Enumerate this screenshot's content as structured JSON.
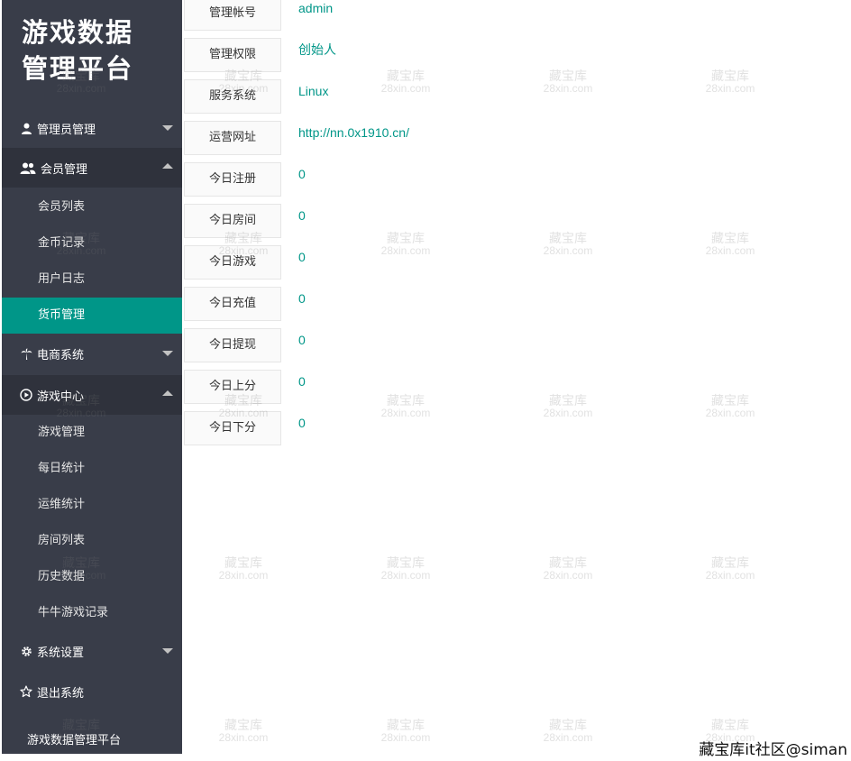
{
  "sidebar": {
    "logo_line1": "游戏数据",
    "logo_line2": "管理平台",
    "groups": [
      {
        "label": "管理员管理",
        "icon": "user-icon",
        "state": "collapsed"
      },
      {
        "label": "会员管理",
        "icon": "users-icon",
        "state": "expanded",
        "items": [
          {
            "label": "会员列表"
          },
          {
            "label": "金币记录"
          },
          {
            "label": "用户日志"
          },
          {
            "label": "货币管理",
            "active": true
          }
        ]
      },
      {
        "label": "电商系统",
        "icon": "palm-tree-icon",
        "state": "collapsed"
      },
      {
        "label": "游戏中心",
        "icon": "play-circle-icon",
        "state": "expanded",
        "items": [
          {
            "label": "游戏管理"
          },
          {
            "label": "每日统计"
          },
          {
            "label": "运维统计"
          },
          {
            "label": "房间列表"
          },
          {
            "label": "历史数据"
          },
          {
            "label": "牛牛游戏记录"
          }
        ]
      },
      {
        "label": "系统设置",
        "icon": "gear-icon",
        "state": "collapsed"
      },
      {
        "label": "退出系统",
        "icon": "star-icon"
      }
    ],
    "footer": "游戏数据管理平台"
  },
  "info": [
    {
      "label": "管理帐号",
      "value": "admin"
    },
    {
      "label": "管理权限",
      "value": "创始人"
    },
    {
      "label": "服务系统",
      "value": "Linux"
    },
    {
      "label": "运营网址",
      "value": "http://nn.0x1910.cn/"
    },
    {
      "label": "今日注册",
      "value": "0"
    },
    {
      "label": "今日房间",
      "value": "0"
    },
    {
      "label": "今日游戏",
      "value": "0"
    },
    {
      "label": "今日充值",
      "value": "0"
    },
    {
      "label": "今日提现",
      "value": "0"
    },
    {
      "label": "今日上分",
      "value": "0"
    },
    {
      "label": "今日下分",
      "value": "0"
    }
  ],
  "watermark": {
    "line1": "藏宝库",
    "line2": "28xin.com"
  },
  "corner_mark": "藏宝库it社区@siman",
  "colors": {
    "sidebar_bg": "#393d49",
    "active_bg": "#009688",
    "value_text": "#009688"
  }
}
